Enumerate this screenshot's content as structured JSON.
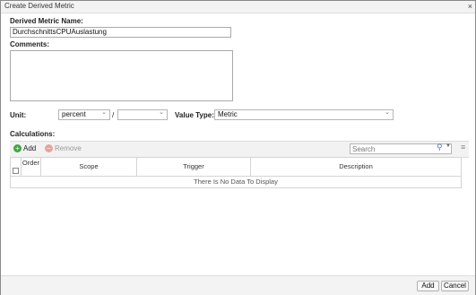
{
  "dialog": {
    "title": "Create Derived Metric",
    "close_glyph": "×"
  },
  "form": {
    "name_label": "Derived Metric Name:",
    "name_value": "DurchschnittsCPUAuslastung",
    "comments_label": "Comments:",
    "comments_value": "",
    "unit_label": "Unit:",
    "unit_value": "percent",
    "unit_separator": "/",
    "unit_denominator": "",
    "value_type_label": "Value Type:",
    "value_type_value": "Metric"
  },
  "calculations": {
    "label": "Calculations:",
    "add_label": "Add",
    "remove_label": "Remove",
    "search_placeholder": "Search",
    "columns": [
      "Order",
      "Scope",
      "Trigger",
      "Description"
    ],
    "empty_text": "There Is No Data To Display"
  },
  "footer": {
    "add_label": "Add",
    "cancel_label": "Cancel"
  },
  "colors": {
    "add_icon": "#3fa63f",
    "remove_icon": "#e8a49a"
  },
  "icons": {
    "add": "plus-circle-icon",
    "remove": "minus-circle-icon",
    "search": "magnifier-icon",
    "columns": "column-menu-icon"
  }
}
